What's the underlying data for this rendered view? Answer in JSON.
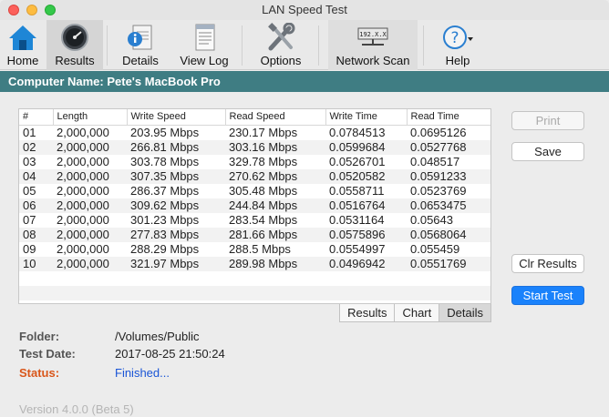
{
  "window": {
    "title": "LAN Speed Test"
  },
  "toolbar": {
    "items": [
      {
        "label": "Home",
        "icon": "home-icon"
      },
      {
        "label": "Results",
        "icon": "speedometer-icon"
      },
      {
        "label": "Details",
        "icon": "info-doc-icon"
      },
      {
        "label": "View Log",
        "icon": "log-icon"
      },
      {
        "label": "Options",
        "icon": "tools-icon"
      },
      {
        "label": "Network Scan",
        "icon": "ip-scan-icon",
        "ip_text": "192.X.X"
      },
      {
        "label": "Help",
        "icon": "help-icon"
      }
    ]
  },
  "computer_name": "Computer Name: Pete's MacBook Pro",
  "table": {
    "headers": [
      "#",
      "Length",
      "Write Speed",
      "Read Speed",
      "Write Time",
      "Read Time"
    ],
    "rows": [
      [
        "01",
        "2,000,000",
        "203.95 Mbps",
        "230.17 Mbps",
        "0.0784513",
        "0.0695126"
      ],
      [
        "02",
        "2,000,000",
        "266.81 Mbps",
        "303.16 Mbps",
        "0.0599684",
        "0.0527768"
      ],
      [
        "03",
        "2,000,000",
        "303.78 Mbps",
        "329.78 Mbps",
        "0.0526701",
        "0.048517"
      ],
      [
        "04",
        "2,000,000",
        "307.35 Mbps",
        "270.62 Mbps",
        "0.0520582",
        "0.0591233"
      ],
      [
        "05",
        "2,000,000",
        "286.37 Mbps",
        "305.48 Mbps",
        "0.0558711",
        "0.0523769"
      ],
      [
        "06",
        "2,000,000",
        "309.62 Mbps",
        "244.84 Mbps",
        "0.0516764",
        "0.0653475"
      ],
      [
        "07",
        "2,000,000",
        "301.23 Mbps",
        "283.54 Mbps",
        "0.0531164",
        "0.05643"
      ],
      [
        "08",
        "2,000,000",
        "277.83 Mbps",
        "281.66 Mbps",
        "0.0575896",
        "0.0568064"
      ],
      [
        "09",
        "2,000,000",
        "288.29 Mbps",
        "288.5 Mbps",
        "0.0554997",
        "0.055459"
      ],
      [
        "10",
        "2,000,000",
        "321.97 Mbps",
        "289.98 Mbps",
        "0.0496942",
        "0.0551769"
      ]
    ]
  },
  "tabs": [
    "Results",
    "Chart",
    "Details"
  ],
  "selected_tab": "Details",
  "buttons": {
    "print": "Print",
    "save": "Save",
    "clear": "Clr Results",
    "start": "Start Test"
  },
  "info": {
    "folder_label": "Folder:",
    "folder_value": "/Volumes/Public",
    "date_label": "Test Date:",
    "date_value": "2017-08-25 21:50:24",
    "status_label": "Status:",
    "status_value": "Finished..."
  },
  "version": "Version 4.0.0 (Beta 5)",
  "colors": {
    "name_bar": "#3f7d83",
    "primary_button": "#1a82fb",
    "status_label": "#d9561a",
    "status_value": "#1a55d6"
  }
}
